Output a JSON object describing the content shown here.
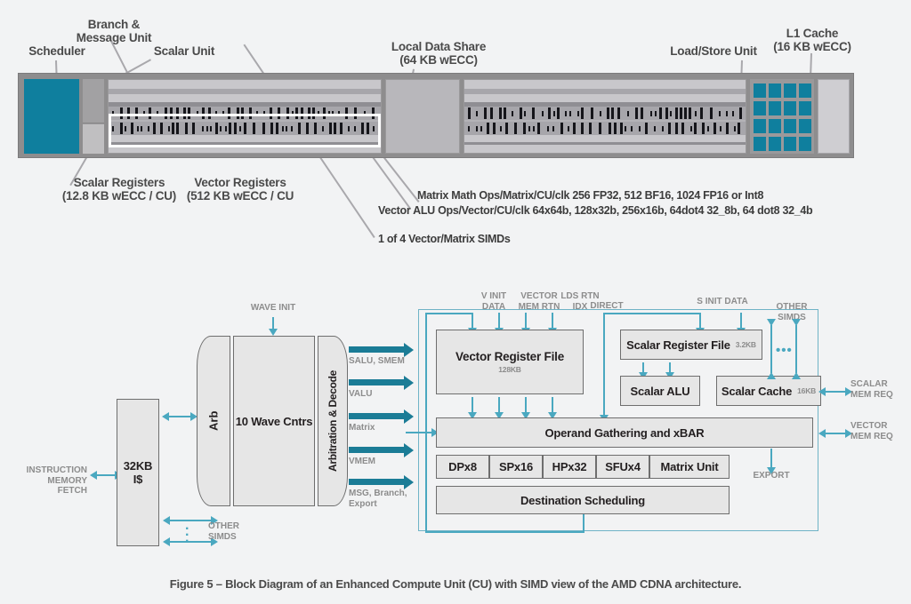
{
  "figure": {
    "caption": "Figure 5 – Block Diagram of an Enhanced Compute Unit (CU) with SIMD view of the AMD CDNA architecture."
  },
  "colors": {
    "accent_teal": "#0f7f9e",
    "arrow_teal": "#1b7c96",
    "line_teal": "#4aa8c0",
    "chip_body": "#8e8d8e",
    "box_fill": "#e6e6e6",
    "box_border": "#6e6e6e",
    "page_bg": "#f2f3f4",
    "label_gray": "#8c8c8c"
  },
  "top_diagram": {
    "name": "Enhanced Compute Unit die shot annotation",
    "callouts": [
      {
        "id": "scheduler",
        "text": "Scheduler"
      },
      {
        "id": "branch-message-unit",
        "text": "Branch &\nMessage Unit"
      },
      {
        "id": "scalar-unit",
        "text": "Scalar Unit"
      },
      {
        "id": "local-data-share",
        "text": "Local Data Share\n(64 KB wECC)"
      },
      {
        "id": "load-store-unit",
        "text": "Load/Store Unit"
      },
      {
        "id": "l1-cache",
        "text": "L1 Cache\n(16 KB wECC)"
      }
    ],
    "notes": [
      {
        "id": "scalar-registers",
        "text": "Scalar Registers\n(12.8 KB wECC / CU)"
      },
      {
        "id": "vector-registers",
        "text": "Vector Registers\n(512 KB wECC / CU"
      },
      {
        "id": "matrix-math-ops",
        "text": "Matrix Math Ops/Matrix/CU/clk 256 FP32, 512 BF16, 1024 FP16 or Int8"
      },
      {
        "id": "vector-alu-ops",
        "text": "Vector ALU Ops/Vector/CU/clk 64x64b, 128x32b, 256x16b, 64dot4 32_8b,  64 dot8 32_4b"
      },
      {
        "id": "one-of-four-simds",
        "text": "1 of 4 Vector/Matrix SIMDs"
      }
    ]
  },
  "block_diagram": {
    "front_end": {
      "instruction_memory_fetch": "INSTRUCTION\nMEMORY FETCH",
      "instruction_cache": "32KB I$",
      "other_simds": "OTHER\nSIMDS",
      "arb": "Arb",
      "wave_controllers": "10 Wave Cntrs",
      "arbitration_decode": "Arbitration & Decode",
      "wave_init": "WAVE INIT"
    },
    "dispatch_arrows": [
      {
        "id": "salu-smem",
        "label": "SALU, SMEM"
      },
      {
        "id": "valu",
        "label": "VALU"
      },
      {
        "id": "matrix",
        "label": "Matrix"
      },
      {
        "id": "vmem",
        "label": "VMEM"
      },
      {
        "id": "msg-branch-export",
        "label": "MSG, Branch,\nExport"
      }
    ],
    "top_inputs": [
      {
        "id": "v-init-data",
        "label": "V INIT\nDATA"
      },
      {
        "id": "vector-mem-rtn",
        "label": "VECTOR\nMEM RTN"
      },
      {
        "id": "lds-rtn-idx",
        "label": "LDS RTN\nIDX"
      },
      {
        "id": "direct",
        "label": "DIRECT"
      },
      {
        "id": "s-init-data",
        "label": "S INIT DATA"
      },
      {
        "id": "other-simds-right",
        "label": "OTHER\nSIMDS"
      }
    ],
    "blocks": [
      {
        "id": "vector-register-file",
        "title": "Vector Register File",
        "size": "128KB"
      },
      {
        "id": "scalar-register-file",
        "title": "Scalar Register File",
        "size": "3.2KB"
      },
      {
        "id": "scalar-alu",
        "title": "Scalar ALU",
        "size": ""
      },
      {
        "id": "scalar-cache",
        "title": "Scalar Cache",
        "size": "16KB"
      },
      {
        "id": "operand-gathering-xbar",
        "title": "Operand Gathering and xBAR",
        "size": ""
      },
      {
        "id": "destination-scheduling",
        "title": "Destination Scheduling",
        "size": ""
      }
    ],
    "execution_units": [
      {
        "id": "dp-unit",
        "label": "DPx8"
      },
      {
        "id": "sp-unit",
        "label": "SPx16"
      },
      {
        "id": "hp-unit",
        "label": "HPx32"
      },
      {
        "id": "sfu-unit",
        "label": "SFUx4"
      },
      {
        "id": "matrix-unit",
        "label": "Matrix Unit"
      }
    ],
    "right_ports": [
      {
        "id": "scalar-mem-req",
        "label": "SCALAR\nMEM REQ"
      },
      {
        "id": "vector-mem-req",
        "label": "VECTOR\nMEM REQ"
      },
      {
        "id": "export",
        "label": "EXPORT"
      }
    ]
  }
}
